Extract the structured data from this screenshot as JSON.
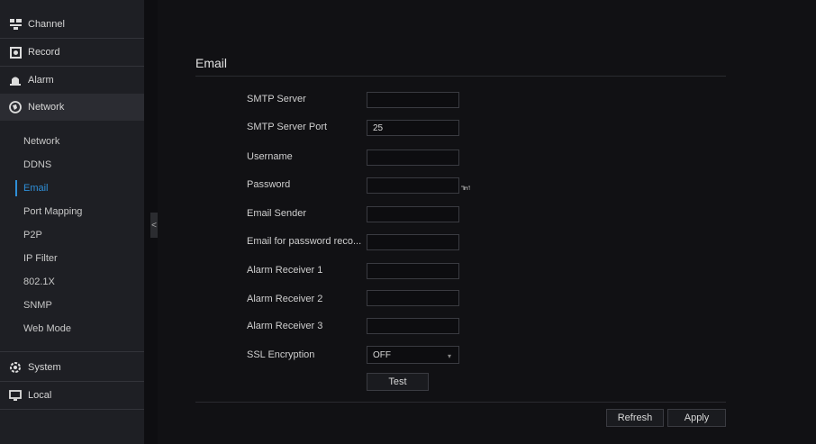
{
  "sidebar": {
    "menu": [
      {
        "label": "Channel",
        "icon": "channel-icon"
      },
      {
        "label": "Record",
        "icon": "record-icon"
      },
      {
        "label": "Alarm",
        "icon": "alarm-icon"
      },
      {
        "label": "Network",
        "icon": "network-icon"
      },
      {
        "label": "System",
        "icon": "system-icon"
      },
      {
        "label": "Local",
        "icon": "local-icon"
      }
    ],
    "network_items": [
      "Network",
      "DDNS",
      "Email",
      "Port Mapping",
      "P2P",
      "IP Filter",
      "802.1X",
      "SNMP",
      "Web Mode"
    ],
    "selected_item": "Email",
    "collapse_glyph": "<"
  },
  "page": {
    "title": "Email"
  },
  "form": {
    "smtp_server": {
      "label": "SMTP Server",
      "value": ""
    },
    "smtp_port": {
      "label": "SMTP Server Port",
      "value": "25"
    },
    "username": {
      "label": "Username",
      "value": ""
    },
    "password": {
      "label": "Password",
      "value": ""
    },
    "sender": {
      "label": "Email Sender",
      "value": ""
    },
    "recovery": {
      "label": "Email for password reco...",
      "value": ""
    },
    "receiver1": {
      "label": "Alarm Receiver 1",
      "value": ""
    },
    "receiver2": {
      "label": "Alarm Receiver 2",
      "value": ""
    },
    "receiver3": {
      "label": "Alarm Receiver 3",
      "value": ""
    },
    "ssl": {
      "label": "SSL Encryption",
      "value": "OFF"
    }
  },
  "buttons": {
    "test": "Test",
    "refresh": "Refresh",
    "apply": "Apply"
  },
  "colors": {
    "accent": "#2f8fd8",
    "sidebar": "#1e1f24",
    "background": "#111114"
  }
}
